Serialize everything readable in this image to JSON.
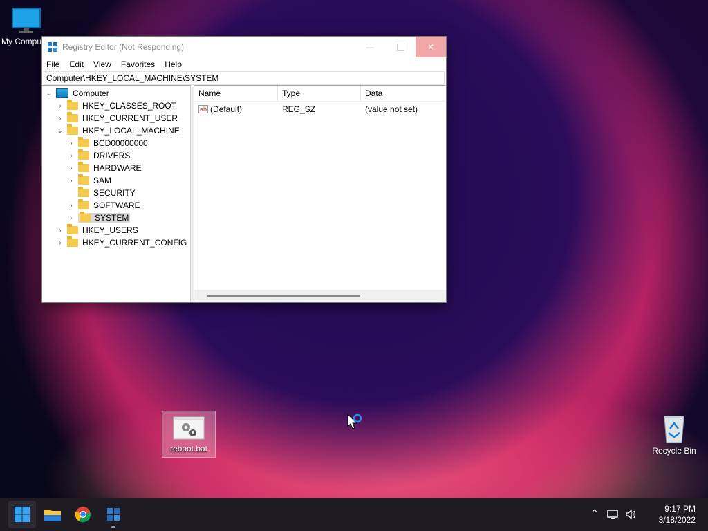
{
  "desktop": {
    "icons": {
      "my_computer": "My Computer",
      "reboot": "reboot.bat",
      "recycle": "Recycle Bin"
    }
  },
  "window": {
    "title": "Registry Editor (Not Responding)",
    "menu": [
      "File",
      "Edit",
      "View",
      "Favorites",
      "Help"
    ],
    "address": "Computer\\HKEY_LOCAL_MACHINE\\SYSTEM",
    "tree": {
      "root": "Computer",
      "hives": [
        "HKEY_CLASSES_ROOT",
        "HKEY_CURRENT_USER",
        "HKEY_LOCAL_MACHINE",
        "HKEY_USERS",
        "HKEY_CURRENT_CONFIG"
      ],
      "hklm_children": [
        "BCD00000000",
        "DRIVERS",
        "HARDWARE",
        "SAM",
        "SECURITY",
        "SOFTWARE",
        "SYSTEM"
      ],
      "selected": "SYSTEM"
    },
    "list": {
      "columns": [
        "Name",
        "Type",
        "Data"
      ],
      "rows": [
        {
          "name": "(Default)",
          "type": "REG_SZ",
          "data": "(value not set)"
        }
      ]
    }
  },
  "taskbar": {
    "apps": [
      "start-button",
      "file-explorer",
      "chrome",
      "registry-editor"
    ],
    "time": "9:17 PM",
    "date": "3/18/2022"
  },
  "colors": {
    "taskbar": "#1e1c22",
    "close_hover": "#f1a7a7",
    "folder": "#f5c94c"
  }
}
